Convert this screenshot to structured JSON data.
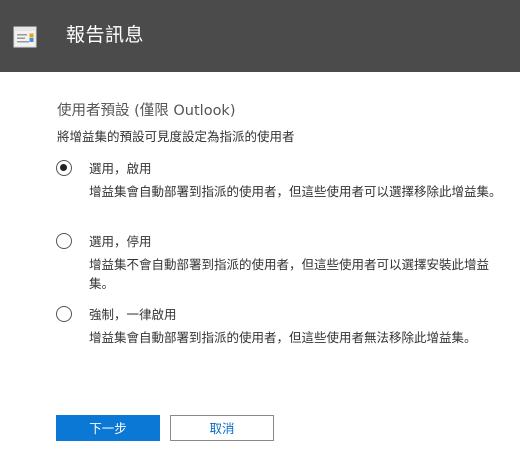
{
  "dialog": {
    "title": "報告訊息",
    "icon": "report-message-icon"
  },
  "section": {
    "heading": "使用者預設 (僅限 Outlook)",
    "description": "將增益集的預設可見度設定為指派的使用者"
  },
  "options": [
    {
      "label": "選用，啟用",
      "description": "增益集會自動部署到指派的使用者，但這些使用者可以選擇移除此增益集。",
      "selected": true
    },
    {
      "label": "選用，停用",
      "description": "增益集不會自動部署到指派的使用者，但這些使用者可以選擇安裝此增益集。",
      "selected": false
    },
    {
      "label": "強制，一律啟用",
      "description": "增益集會自動部署到指派的使用者，但這些使用者無法移除此增益集。",
      "selected": false
    }
  ],
  "buttons": {
    "next": "下一步",
    "cancel": "取消"
  },
  "colors": {
    "titlebar": "#4b4b4b",
    "primary": "#0a78d4",
    "link": "#0a6cc4"
  }
}
